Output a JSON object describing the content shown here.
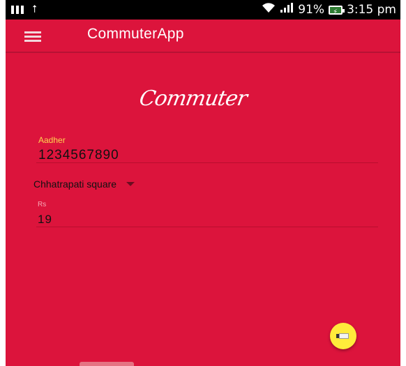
{
  "status_bar": {
    "battery_percent": "91%",
    "time": "3:15 pm",
    "icons": [
      "sim-icon",
      "usb-icon",
      "wifi-icon",
      "signal-icon",
      "battery-icon"
    ]
  },
  "app_bar": {
    "title": "CommuterApp",
    "menu_icon": "hamburger-menu-icon"
  },
  "logo": {
    "text": "Commuter"
  },
  "form": {
    "aadhar_label": "Aadher",
    "aadhar_value": "1234567890",
    "route_selected": "Chhatrapati square",
    "rs_label": "Rs",
    "rs_value": "19"
  },
  "fab": {
    "icon": "ticket-icon"
  },
  "colors": {
    "primary": "#dc143c",
    "accent": "#ffeb3b",
    "label_active": "#ffd54f"
  }
}
